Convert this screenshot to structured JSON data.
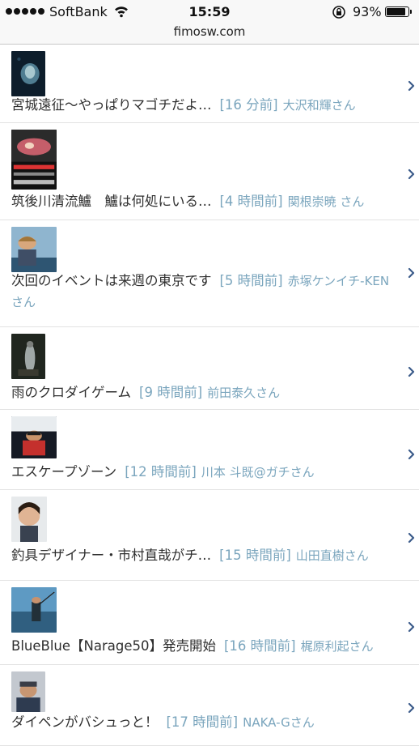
{
  "status_bar": {
    "carrier": "SoftBank",
    "time": "15:59",
    "battery_percent": "93%",
    "battery_level": 0.93,
    "signal_bars": 5
  },
  "url_bar": {
    "url": "fimosw.com"
  },
  "feed": [
    {
      "title": "宮城遠征〜やっぱりマゴチだよ…",
      "time": "[16 分前]",
      "author": "大沢和輝さん",
      "thumb_icon": "night-fish-photo-icon"
    },
    {
      "title": "筑後川清流鱸　鱸は何処にいる…",
      "time": "[4 時間前]",
      "author": "関根崇暁 さん",
      "thumb_icon": "lure-photo-icon"
    },
    {
      "title": "次回のイベントは来週の東京です",
      "time": "[5 時間前]",
      "author": "赤塚ケンイチ-KENさん",
      "thumb_icon": "portrait-photo-icon"
    },
    {
      "title": "雨のクロダイゲーム",
      "time": "[9 時間前]",
      "author": "前田泰久さん",
      "thumb_icon": "fish-catch-photo-icon"
    },
    {
      "title": "エスケープゾーン",
      "time": "[12 時間前]",
      "author": "川本 斗既@ガチさん",
      "thumb_icon": "angler-photo-icon"
    },
    {
      "title": "釣具デザイナー・市村直哉がチ…",
      "time": "[15 時間前]",
      "author": "山田直樹さん",
      "thumb_icon": "face-photo-icon"
    },
    {
      "title": "BlueBlue【Narage50】発売開始",
      "time": "[16 時間前]",
      "author": "梶原利起さん",
      "thumb_icon": "sea-fishing-photo-icon"
    },
    {
      "title": "ダイペンがバシュっと！",
      "time": "[17 時間前]",
      "author": "NAKA-Gさん",
      "thumb_icon": "angler-cap-photo-icon"
    }
  ]
}
